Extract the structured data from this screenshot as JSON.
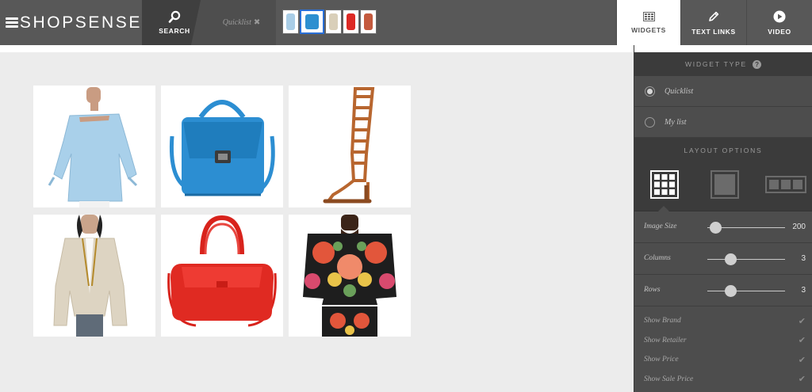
{
  "app": {
    "brand": "SHOPSENSE"
  },
  "toolbar": {
    "search_label": "SEARCH",
    "quicklist_label": "Quicklist",
    "quicklist_close": "✖",
    "thumbnails": [
      {
        "name": "light-blue-top-thumb",
        "color": "#a9cde6"
      },
      {
        "name": "blue-bag-thumb",
        "color": "#2d8fd0",
        "selected": true
      },
      {
        "name": "blazer-thumb",
        "color": "#d9cfb9"
      },
      {
        "name": "red-bag-thumb",
        "color": "#dd2a25"
      },
      {
        "name": "floral-top-thumb",
        "color": "#c45a3e"
      }
    ]
  },
  "nav": {
    "tabs": [
      {
        "key": "widgets",
        "label": "WIDGETS",
        "active": true
      },
      {
        "key": "text-links",
        "label": "TEXT LINKS",
        "active": false
      },
      {
        "key": "video",
        "label": "VIDEO",
        "active": false
      }
    ]
  },
  "products": [
    {
      "name": "off-shoulder-blue-top",
      "color": "#a9d0ea"
    },
    {
      "name": "blue-satchel-bag",
      "color": "#2c8ed2"
    },
    {
      "name": "gladiator-sandal",
      "color": "#b8662f"
    },
    {
      "name": "beige-blazer",
      "color": "#ddd4c2"
    },
    {
      "name": "red-tote-bag",
      "color": "#e02a22"
    },
    {
      "name": "floral-crop-top",
      "color": "#d0523a"
    }
  ],
  "sidebar": {
    "widget_type_title": "WIDGET TYPE",
    "help_icon": "?",
    "widget_types": [
      {
        "label": "Quicklist",
        "selected": true
      },
      {
        "label": "My list",
        "selected": false
      }
    ],
    "layout_title": "LAYOUT OPTIONS",
    "layout_choices": [
      "grid",
      "single",
      "row"
    ],
    "selected_layout": "grid",
    "sliders": [
      {
        "label": "Image Size",
        "value": "200",
        "level": 0.1
      },
      {
        "label": "Columns",
        "value": "3",
        "level": 0.3
      },
      {
        "label": "Rows",
        "value": "3",
        "level": 0.3
      }
    ],
    "checks": [
      {
        "label": "Show Brand",
        "mark": "✔"
      },
      {
        "label": "Show Retailer",
        "mark": "✔"
      },
      {
        "label": "Show Price",
        "mark": "✔"
      },
      {
        "label": "Show Sale Price",
        "mark": "✔"
      }
    ]
  },
  "colors": {
    "topbar": "#585858",
    "sidebar": "#4d4d4d",
    "selected_thumb_border": "#2a6fd6"
  }
}
